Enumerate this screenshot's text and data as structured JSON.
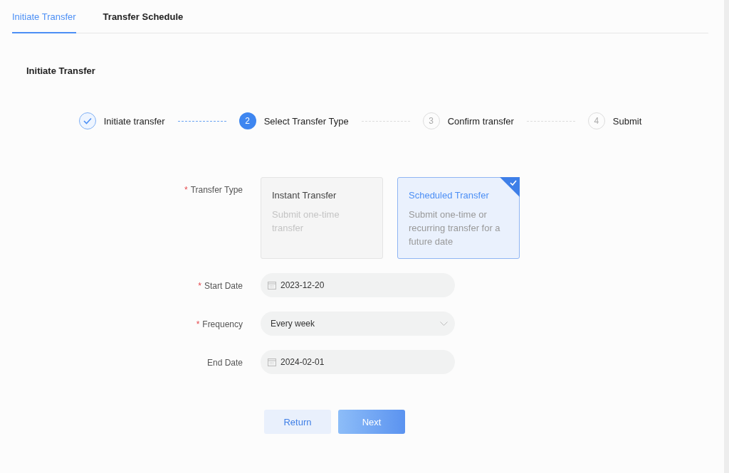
{
  "tabs": [
    {
      "label": "Initiate Transfer",
      "selected": true
    },
    {
      "label": "Transfer Schedule",
      "selected": false
    }
  ],
  "section_title": "Initiate Transfer",
  "steps": [
    {
      "label": "Initiate transfer",
      "completed": true,
      "selected": false
    },
    {
      "number": "2",
      "label": "Select Transfer Type",
      "completed": false,
      "selected": true
    },
    {
      "number": "3",
      "label": "Confirm transfer",
      "completed": false,
      "selected": false
    },
    {
      "number": "4",
      "label": "Submit",
      "completed": false,
      "selected": false
    }
  ],
  "transfer_type": {
    "label": "Transfer Type",
    "required_mark": "*",
    "options": [
      {
        "title": "Instant Transfer",
        "description": "Submit one-time transfer",
        "selected": false
      },
      {
        "title": "Scheduled Transfer",
        "description": "Submit one-time or recurring transfer for a future date",
        "selected": true
      }
    ]
  },
  "fields": [
    {
      "kind": "date",
      "label": "Start Date",
      "required_mark": "*",
      "value": "2023-12-20"
    },
    {
      "kind": "select",
      "label": "Frequency",
      "required_mark": "*",
      "value": "Every week"
    },
    {
      "kind": "date",
      "label": "End Date",
      "value": "2024-02-01"
    }
  ],
  "buttons": [
    {
      "kind": "secondary",
      "label": "Return"
    },
    {
      "kind": "primary",
      "label": "Next"
    }
  ]
}
